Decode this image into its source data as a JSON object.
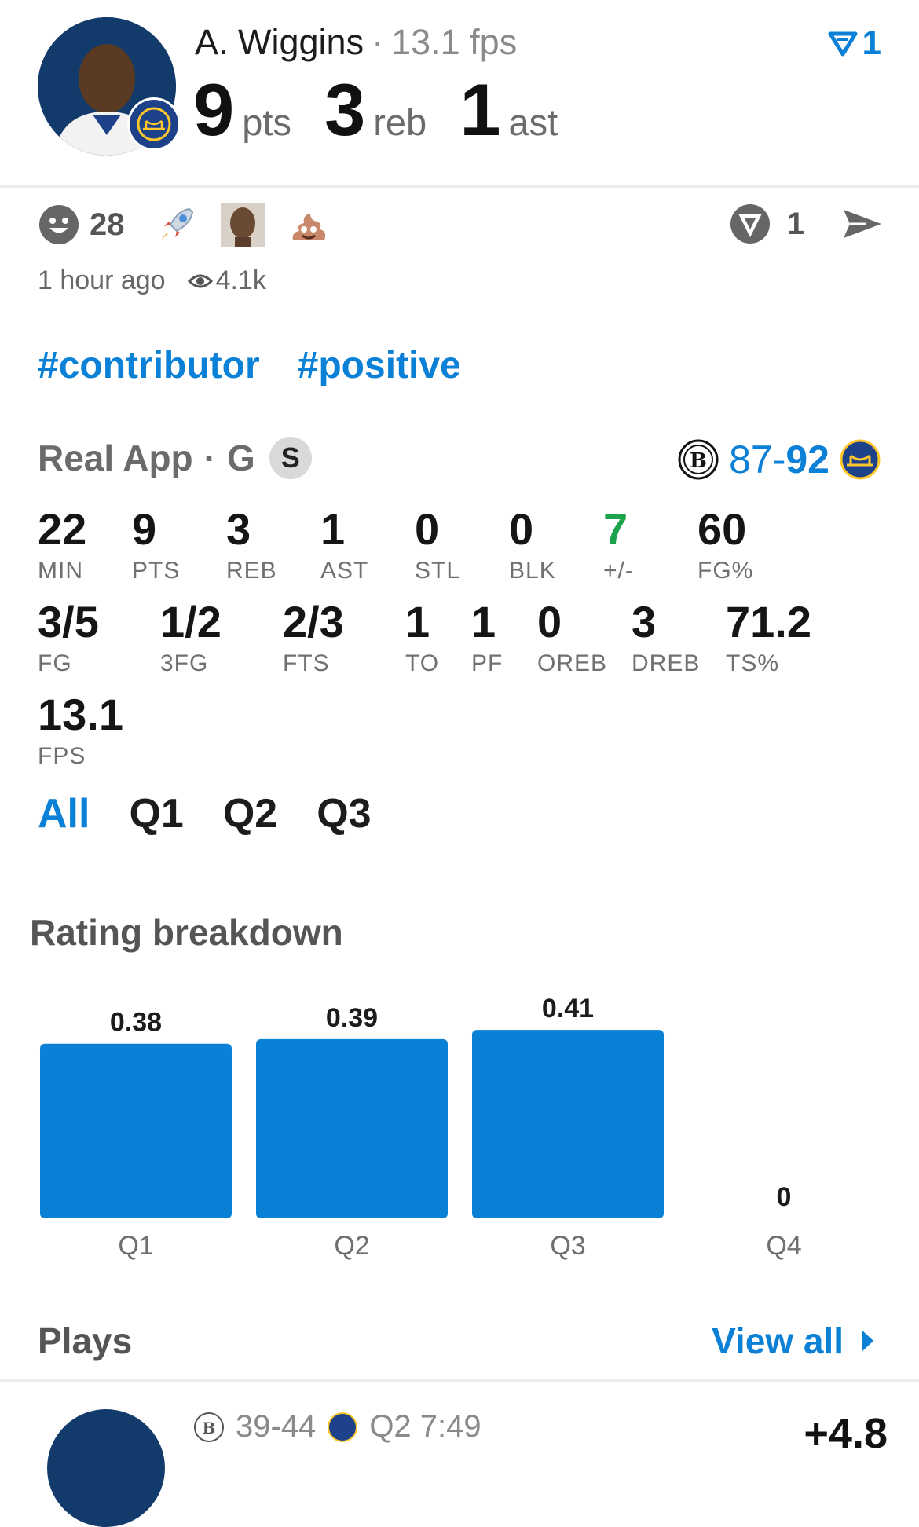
{
  "header": {
    "player_name": "A. Wiggins",
    "separator": "·",
    "fps_text": "13.1 fps",
    "pts": "9",
    "pts_unit": "pts",
    "reb": "3",
    "reb_unit": "reb",
    "ast": "1",
    "ast_unit": "ast",
    "vote_count": "1",
    "vote_icon": "upvote-triangle-icon"
  },
  "reactions": {
    "smile_count": "28",
    "items": [
      "smile-face-icon",
      "rocket-emoji",
      "player-face-emoji",
      "poop-emoji"
    ],
    "badge_count": "1"
  },
  "meta": {
    "time_ago": "1 hour ago",
    "views": "4.1k"
  },
  "tags": [
    "#contributor",
    "#positive"
  ],
  "game": {
    "league": "Real App",
    "dot": "·",
    "position": "G",
    "starter_badge": "S",
    "away_score": "87",
    "dash": "-",
    "home_score": "92"
  },
  "stats_row1": [
    {
      "v": "22",
      "l": "MIN"
    },
    {
      "v": "9",
      "l": "PTS"
    },
    {
      "v": "3",
      "l": "REB"
    },
    {
      "v": "1",
      "l": "AST"
    },
    {
      "v": "0",
      "l": "STL"
    },
    {
      "v": "0",
      "l": "BLK"
    },
    {
      "v": "7",
      "l": "+/-"
    },
    {
      "v": "60",
      "l": "FG%"
    }
  ],
  "stats_row2": [
    {
      "v": "3/5",
      "l": "FG"
    },
    {
      "v": "1/2",
      "l": "3FG"
    },
    {
      "v": "2/3",
      "l": "FTS"
    },
    {
      "v": "1",
      "l": "TO"
    },
    {
      "v": "1",
      "l": "PF"
    },
    {
      "v": "0",
      "l": "OREB"
    },
    {
      "v": "3",
      "l": "DREB"
    },
    {
      "v": "71.2",
      "l": "TS%"
    }
  ],
  "stats_row3": [
    {
      "v": "13.1",
      "l": "FPS"
    }
  ],
  "quarter_tabs": [
    "All",
    "Q1",
    "Q2",
    "Q3"
  ],
  "rating_title": "Rating breakdown",
  "chart_data": {
    "type": "bar",
    "categories": [
      "Q1",
      "Q2",
      "Q3",
      "Q4"
    ],
    "values": [
      0.38,
      0.39,
      0.41,
      0
    ],
    "value_labels": [
      "0.38",
      "0.39",
      "0.41",
      "0"
    ],
    "color": "#0a80d6"
  },
  "plays": {
    "title": "Plays",
    "view_all": "View all",
    "first_play_score": "39-44",
    "first_play_time": "Q2 7:49",
    "first_play_value": "+4.8"
  },
  "colors": {
    "accent": "#0a80d6",
    "positive": "#1aa34a"
  }
}
